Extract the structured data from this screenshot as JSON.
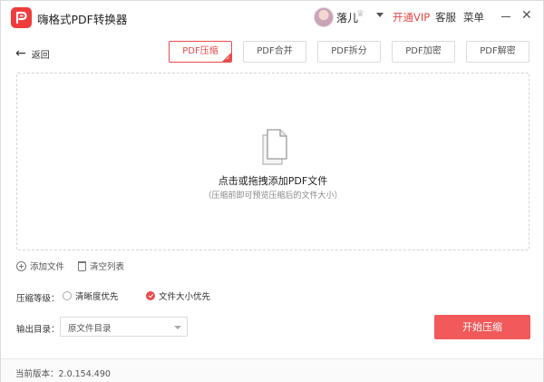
{
  "app": {
    "title": "嗨格式PDF转换器"
  },
  "user": {
    "name": "落儿"
  },
  "header": {
    "vip_label": "开通VIP",
    "service_label": "客服",
    "menu_label": "菜单"
  },
  "nav": {
    "back_label": "返回",
    "tabs": [
      {
        "label": "PDF压缩",
        "active": true
      },
      {
        "label": "PDF合并",
        "active": false
      },
      {
        "label": "PDF拆分",
        "active": false
      },
      {
        "label": "PDF加密",
        "active": false
      },
      {
        "label": "PDF解密",
        "active": false
      }
    ]
  },
  "dropzone": {
    "title": "点击或拖拽添加PDF文件",
    "hint": "（压缩前即可预览压缩后的文件大小）"
  },
  "file_actions": {
    "add_label": "添加文件",
    "clear_label": "清空列表"
  },
  "compression": {
    "level_label": "压缩等级：",
    "options": [
      {
        "label": "清晰度优先",
        "checked": false
      },
      {
        "label": "文件大小优先",
        "checked": true
      }
    ]
  },
  "output": {
    "label": "输出目录：",
    "selected": "原文件目录"
  },
  "start_button": {
    "label": "开始压缩"
  },
  "footer": {
    "version_text": "当前版本：2.0.154.490"
  },
  "colors": {
    "accent": "#e94c4c",
    "button": "#f1595a",
    "logo": "#ee3b3b"
  }
}
